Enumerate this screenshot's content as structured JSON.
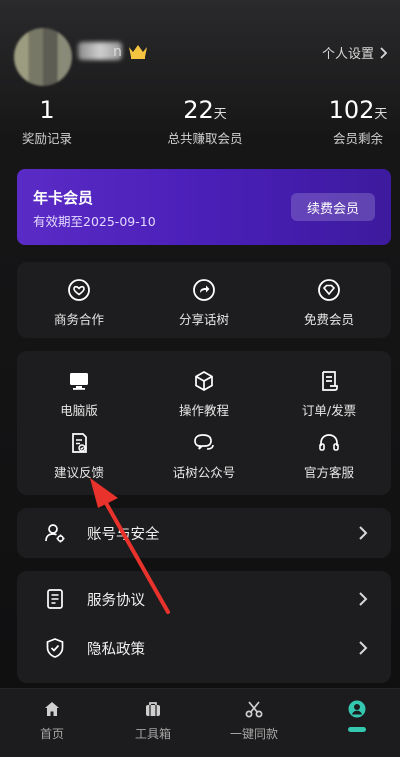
{
  "header": {
    "nickname_suffix": "n",
    "settings_label": "个人设置",
    "crown_color": "#f5c542"
  },
  "stats": [
    {
      "value": "1",
      "unit": "",
      "label": "奖励记录"
    },
    {
      "value": "22",
      "unit": "天",
      "label": "总共赚取会员"
    },
    {
      "value": "102",
      "unit": "天",
      "label": "会员剩余"
    }
  ],
  "membership": {
    "title": "年卡会员",
    "expiry": "有效期至2025-09-10",
    "renew_label": "续费会员",
    "gradient_start": "#5b2bc6",
    "gradient_end": "#3d1a9e"
  },
  "quick_actions": [
    {
      "label": "商务合作",
      "icon": "handshake-icon"
    },
    {
      "label": "分享话树",
      "icon": "share-icon"
    },
    {
      "label": "免费会员",
      "icon": "diamond-icon"
    }
  ],
  "tools": [
    {
      "label": "电脑版",
      "icon": "monitor-icon"
    },
    {
      "label": "操作教程",
      "icon": "cube-icon"
    },
    {
      "label": "订单/发票",
      "icon": "receipt-icon"
    },
    {
      "label": "建议反馈",
      "icon": "feedback-icon"
    },
    {
      "label": "话树公众号",
      "icon": "chat-bubble-icon"
    },
    {
      "label": "官方客服",
      "icon": "headset-icon"
    }
  ],
  "account_row": {
    "label": "账号与安全",
    "icon": "user-settings-icon"
  },
  "policy_rows": [
    {
      "label": "服务协议",
      "icon": "document-icon"
    },
    {
      "label": "隐私政策",
      "icon": "shield-check-icon"
    }
  ],
  "tabbar": [
    {
      "label": "首页",
      "icon": "home-icon"
    },
    {
      "label": "工具箱",
      "icon": "toolbox-icon"
    },
    {
      "label": "一键同款",
      "icon": "scissors-icon"
    },
    {
      "label": "",
      "icon": "profile-icon",
      "active": true
    }
  ],
  "colors": {
    "accent": "#34c8b0",
    "annotation_arrow": "#e8322b"
  }
}
